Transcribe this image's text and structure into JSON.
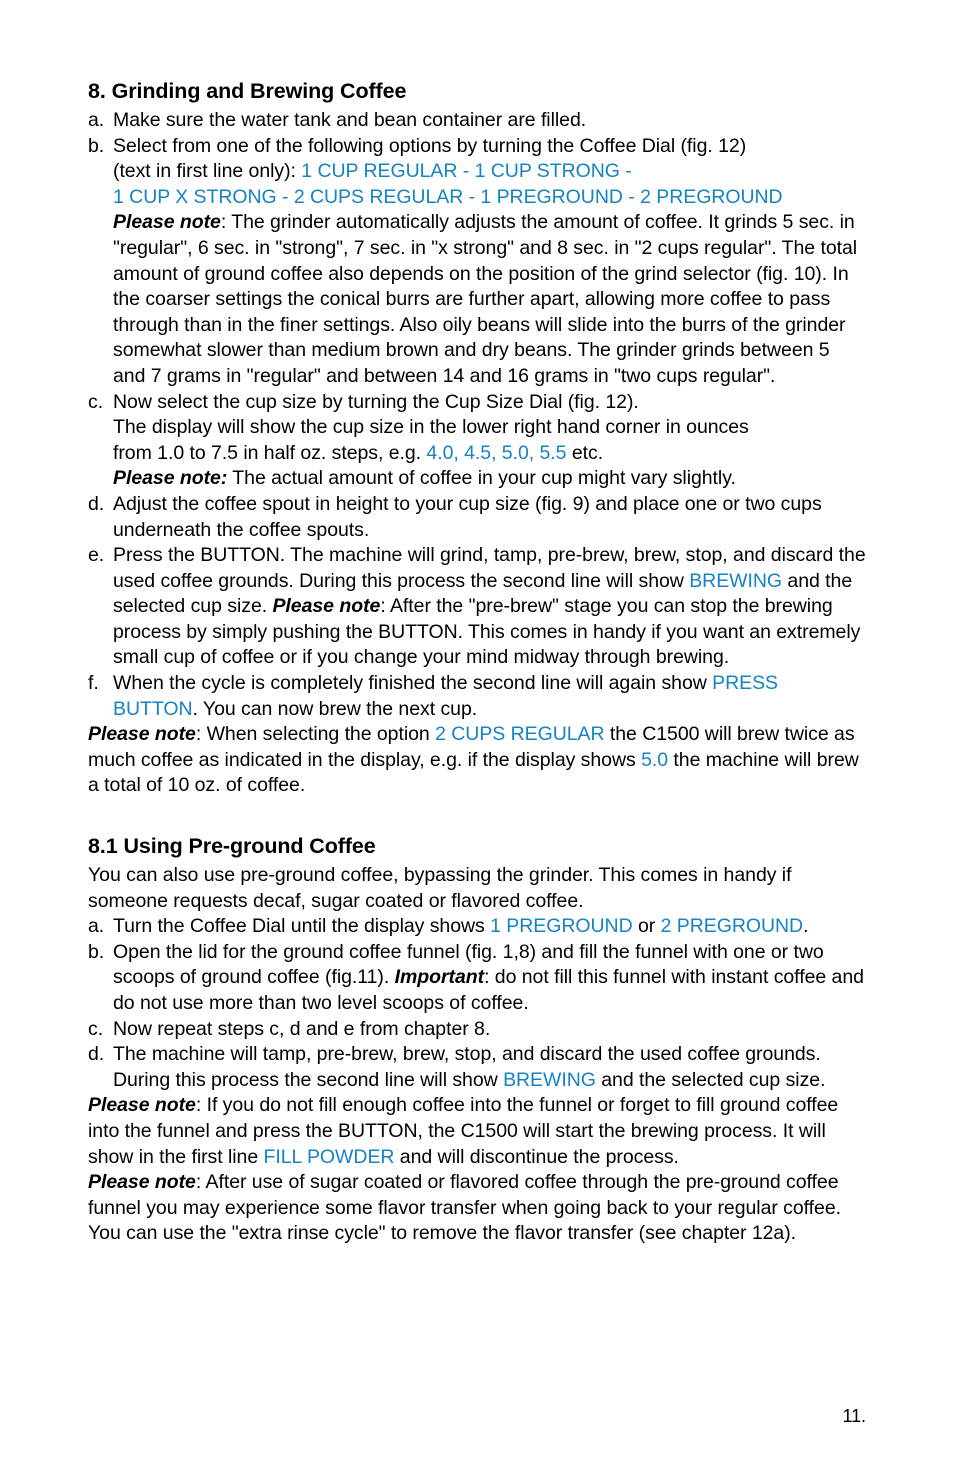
{
  "colors": {
    "display_text": "#1583c4",
    "body_text": "#000000",
    "page_background": "#ffffff"
  },
  "page": {
    "number": "11."
  },
  "section_8": {
    "heading": "8. Grinding and Brewing Coffee",
    "items": [
      {
        "marker": "a.",
        "text": "Make sure the water tank and bean container are filled."
      },
      {
        "marker": "b.",
        "line1": "Select from one of the following options by turning the Coffee Dial (fig. 12)",
        "line2_prefix": "(text in first line only): ",
        "options_line1": "1 CUP REGULAR - 1 CUP STRONG - ",
        "options_line2": "1 CUP X STRONG - 2 CUPS REGULAR - 1 PREGROUND - 2 PREGROUND",
        "note_label": "Please note",
        "note_text": ": The grinder automatically adjusts the amount of coffee. It grinds 5 sec. in \"regular\", 6 sec. in \"strong\", 7 sec. in \"x strong\" and 8 sec. in \"2 cups regular\". The total amount of ground coffee also depends on the position of the grind selector (fig. 10). In the coarser settings the conical burrs are further apart, allowing more coffee to pass through than in the finer settings. Also oily beans will slide into the burrs of the grinder somewhat slower than medium brown and dry beans. The grinder grinds between 5 and 7 grams in \"regular\" and between 14 and 16 grams in \"two cups regular\"."
      },
      {
        "marker": "c.",
        "line1": "Now select the cup size by turning the Cup Size Dial (fig. 12).",
        "line2": "The display will show the cup size in the lower right hand corner in ounces",
        "line3_prefix": "from 1.0 to 7.5 in half oz. steps, e.g. ",
        "line3_values": "4.0, 4.5, 5.0, 5.5",
        "line3_suffix": " etc.",
        "note_label": "Please note:",
        "note_text": " The actual amount of coffee in your cup might vary slightly."
      },
      {
        "marker": "d.",
        "text": "Adjust the coffee spout in height to your cup size (fig. 9) and place one or two cups underneath the coffee spouts."
      },
      {
        "marker": "e.",
        "text_part1": "Press the BUTTON. The machine will grind, tamp, pre-brew, brew, stop, and discard the used coffee grounds. During this process the second line will show ",
        "display1": "BREWING",
        "text_part2": " and the selected cup size. ",
        "note_label": "Please note",
        "text_part3": ": After the \"pre-brew\" stage you can stop the brewing process by simply pushing the BUTTON. This comes in handy if you want an extremely small cup of coffee or if you change your mind midway through brewing."
      },
      {
        "marker": "f.",
        "text_part1": "When the cycle is completely finished the second line will again show ",
        "display1": "PRESS BUTTON",
        "text_part2": ". You can now brew the next cup."
      }
    ],
    "closing_note": {
      "label": "Please note",
      "part1": ": When selecting the option ",
      "display1": "2 CUPS REGULAR",
      "part2": " the C1500 will brew twice as much coffee as indicated in the display, e.g. if the display shows ",
      "display2": "5.0",
      "part3": " the machine will brew a total of 10 oz. of coffee."
    }
  },
  "section_8_1": {
    "heading": "8.1 Using Pre-ground Coffee",
    "intro": "You can also use pre-ground coffee, bypassing the grinder. This comes in handy if someone requests decaf, sugar coated or flavored coffee.",
    "items": [
      {
        "marker": "a.",
        "text_part1": "Turn the Coffee Dial until the display shows ",
        "display1": "1 PREGROUND",
        "text_part2": " or ",
        "display2": "2 PREGROUND",
        "text_part3": "."
      },
      {
        "marker": "b.",
        "text_part1": "Open the lid for the ground coffee funnel (fig. 1,8) and fill the funnel with one or two scoops of ground coffee (fig.11). ",
        "note_label": "Important",
        "text_part2": ": do not fill this funnel with instant coffee and do not use more than two level scoops of coffee."
      },
      {
        "marker": "c.",
        "text": "Now repeat steps c, d and e from chapter 8."
      },
      {
        "marker": "d.",
        "text_part1": "The machine will tamp, pre-brew, brew, stop, and discard the used coffee grounds. During this process the second line will show ",
        "display1": "BREWING",
        "text_part2": " and the selected cup size."
      }
    ],
    "note_1": {
      "label": "Please note",
      "part1": ": If you do not fill enough coffee into the funnel or forget to fill ground coffee into the funnel and press the BUTTON, the C1500 will start the brewing process. It will show in the first line ",
      "display1": "FILL POWDER",
      "part2": " and will discontinue the process."
    },
    "note_2": {
      "label": "Please note",
      "part1": ": After use of sugar coated or flavored coffee through the pre-ground coffee funnel you may experience some flavor transfer when going back to your regular coffee. You can use the \"extra rinse cycle\" to remove the flavor transfer (see chapter 12a)."
    }
  }
}
